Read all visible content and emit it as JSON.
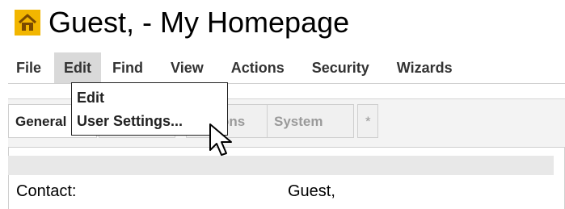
{
  "header": {
    "title": "Guest, - My Homepage",
    "icon": "home-icon"
  },
  "menubar": {
    "items": [
      {
        "label": "File"
      },
      {
        "label": "Edit"
      },
      {
        "label": "Find"
      },
      {
        "label": "View"
      },
      {
        "label": "Actions"
      },
      {
        "label": "Security"
      },
      {
        "label": "Wizards"
      }
    ]
  },
  "dropdown": {
    "items": [
      {
        "label": "Edit"
      },
      {
        "label": "User Settings..."
      }
    ]
  },
  "tabs": [
    {
      "label": "General"
    },
    {
      "label": ""
    },
    {
      "label": "Options"
    },
    {
      "label": "System"
    },
    {
      "label": "*"
    }
  ],
  "content": {
    "contact_label": "Contact:",
    "contact_value": "Guest,"
  },
  "colors": {
    "icon_bg": "#F2B600",
    "icon_fg": "#7a4a00",
    "menu_active_bg": "#d9d9d9"
  }
}
